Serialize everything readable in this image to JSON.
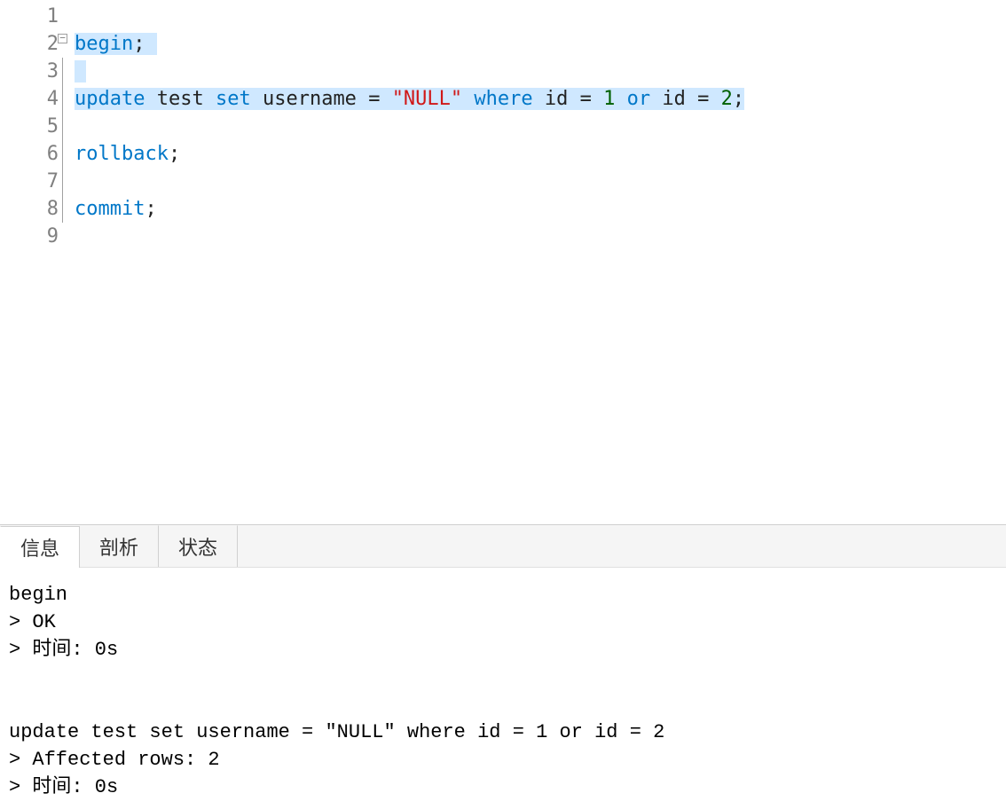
{
  "editor": {
    "line_numbers": [
      "1",
      "2",
      "3",
      "4",
      "5",
      "6",
      "7",
      "8",
      "9"
    ],
    "lines": {
      "1": [],
      "2": [
        {
          "t": "begin",
          "c": "kw",
          "sel": true
        },
        {
          "t": ";",
          "c": "punct",
          "sel": true
        },
        {
          "t": " ",
          "c": "punct",
          "sel": true
        }
      ],
      "3": [
        {
          "t": " ",
          "c": "punct",
          "sel": true
        }
      ],
      "4": [
        {
          "t": "update",
          "c": "kw",
          "sel": true
        },
        {
          "t": " ",
          "c": "ident",
          "sel": true
        },
        {
          "t": "test",
          "c": "ident",
          "sel": true
        },
        {
          "t": " ",
          "c": "ident",
          "sel": true
        },
        {
          "t": "set",
          "c": "kw",
          "sel": true
        },
        {
          "t": " ",
          "c": "ident",
          "sel": true
        },
        {
          "t": "username",
          "c": "ident",
          "sel": true
        },
        {
          "t": " ",
          "c": "ident",
          "sel": true
        },
        {
          "t": "=",
          "c": "punct",
          "sel": true
        },
        {
          "t": " ",
          "c": "ident",
          "sel": true
        },
        {
          "t": "\"NULL\"",
          "c": "str",
          "sel": true
        },
        {
          "t": " ",
          "c": "ident",
          "sel": true
        },
        {
          "t": "where",
          "c": "kw",
          "sel": true
        },
        {
          "t": " ",
          "c": "ident",
          "sel": true
        },
        {
          "t": "id",
          "c": "ident",
          "sel": true
        },
        {
          "t": " ",
          "c": "ident",
          "sel": true
        },
        {
          "t": "=",
          "c": "punct",
          "sel": true
        },
        {
          "t": " ",
          "c": "ident",
          "sel": true
        },
        {
          "t": "1",
          "c": "num",
          "sel": true
        },
        {
          "t": " ",
          "c": "ident",
          "sel": true
        },
        {
          "t": "or",
          "c": "kw",
          "sel": true
        },
        {
          "t": " ",
          "c": "ident",
          "sel": true
        },
        {
          "t": "id",
          "c": "ident",
          "sel": true
        },
        {
          "t": " ",
          "c": "ident",
          "sel": true
        },
        {
          "t": "=",
          "c": "punct",
          "sel": true
        },
        {
          "t": " ",
          "c": "ident",
          "sel": true
        },
        {
          "t": "2",
          "c": "num",
          "sel": true
        },
        {
          "t": ";",
          "c": "punct",
          "sel": true
        }
      ],
      "5": [],
      "6": [
        {
          "t": "rollback",
          "c": "kw",
          "sel": false
        },
        {
          "t": ";",
          "c": "punct",
          "sel": false
        }
      ],
      "7": [],
      "8": [
        {
          "t": "commit",
          "c": "kw",
          "sel": false
        },
        {
          "t": ";",
          "c": "punct",
          "sel": false
        }
      ],
      "9": []
    },
    "fold_start": 2,
    "fold_end": 8
  },
  "tabs": {
    "items": [
      {
        "label": "信息",
        "active": true
      },
      {
        "label": "剖析",
        "active": false
      },
      {
        "label": "状态",
        "active": false
      }
    ]
  },
  "output": {
    "text": "begin\n> OK\n> 时间: 0s\n\n\nupdate test set username = \"NULL\" where id = 1 or id = 2\n> Affected rows: 2\n> 时间: 0s\n"
  }
}
